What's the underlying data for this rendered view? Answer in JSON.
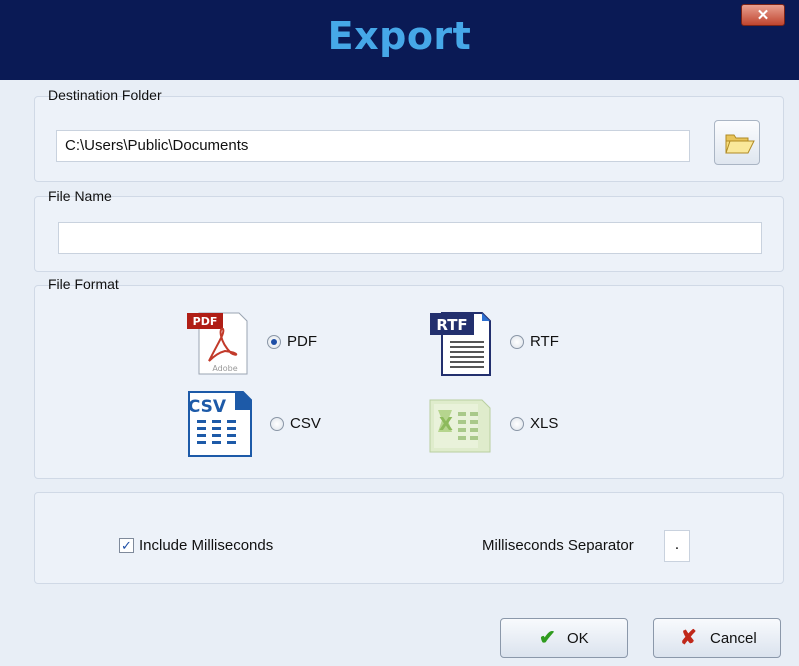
{
  "window": {
    "title": "Export",
    "close_glyph": "✕",
    "title_color": "#46a8e8",
    "titlebar_color": "#0a1a55"
  },
  "destination": {
    "label": "Destination Folder",
    "value": "C:\\Users\\Public\\Documents",
    "browse_icon": "folder-icon"
  },
  "file_name": {
    "label": "File Name",
    "value": ""
  },
  "file_format": {
    "label": "File Format",
    "options": [
      {
        "label": "PDF",
        "icon": "pdf-icon",
        "icon_text": "PDF",
        "icon_subtext": "Adobe",
        "checked": true
      },
      {
        "label": "RTF",
        "icon": "rtf-icon",
        "icon_text": "RTF",
        "checked": false
      },
      {
        "label": "CSV",
        "icon": "csv-icon",
        "icon_text": "CSV",
        "checked": false
      },
      {
        "label": "XLS",
        "icon": "xls-icon",
        "checked": false
      }
    ]
  },
  "options": {
    "include_ms_label": "Include Milliseconds",
    "include_ms_checked": true,
    "check_glyph": "✓",
    "separator_label": "Milliseconds Separator",
    "separator_value": "."
  },
  "buttons": {
    "ok_label": "OK",
    "ok_icon": "✔",
    "ok_icon_color": "#2f9b1e",
    "cancel_label": "Cancel",
    "cancel_icon": "✘",
    "cancel_icon_color": "#c0281a"
  }
}
